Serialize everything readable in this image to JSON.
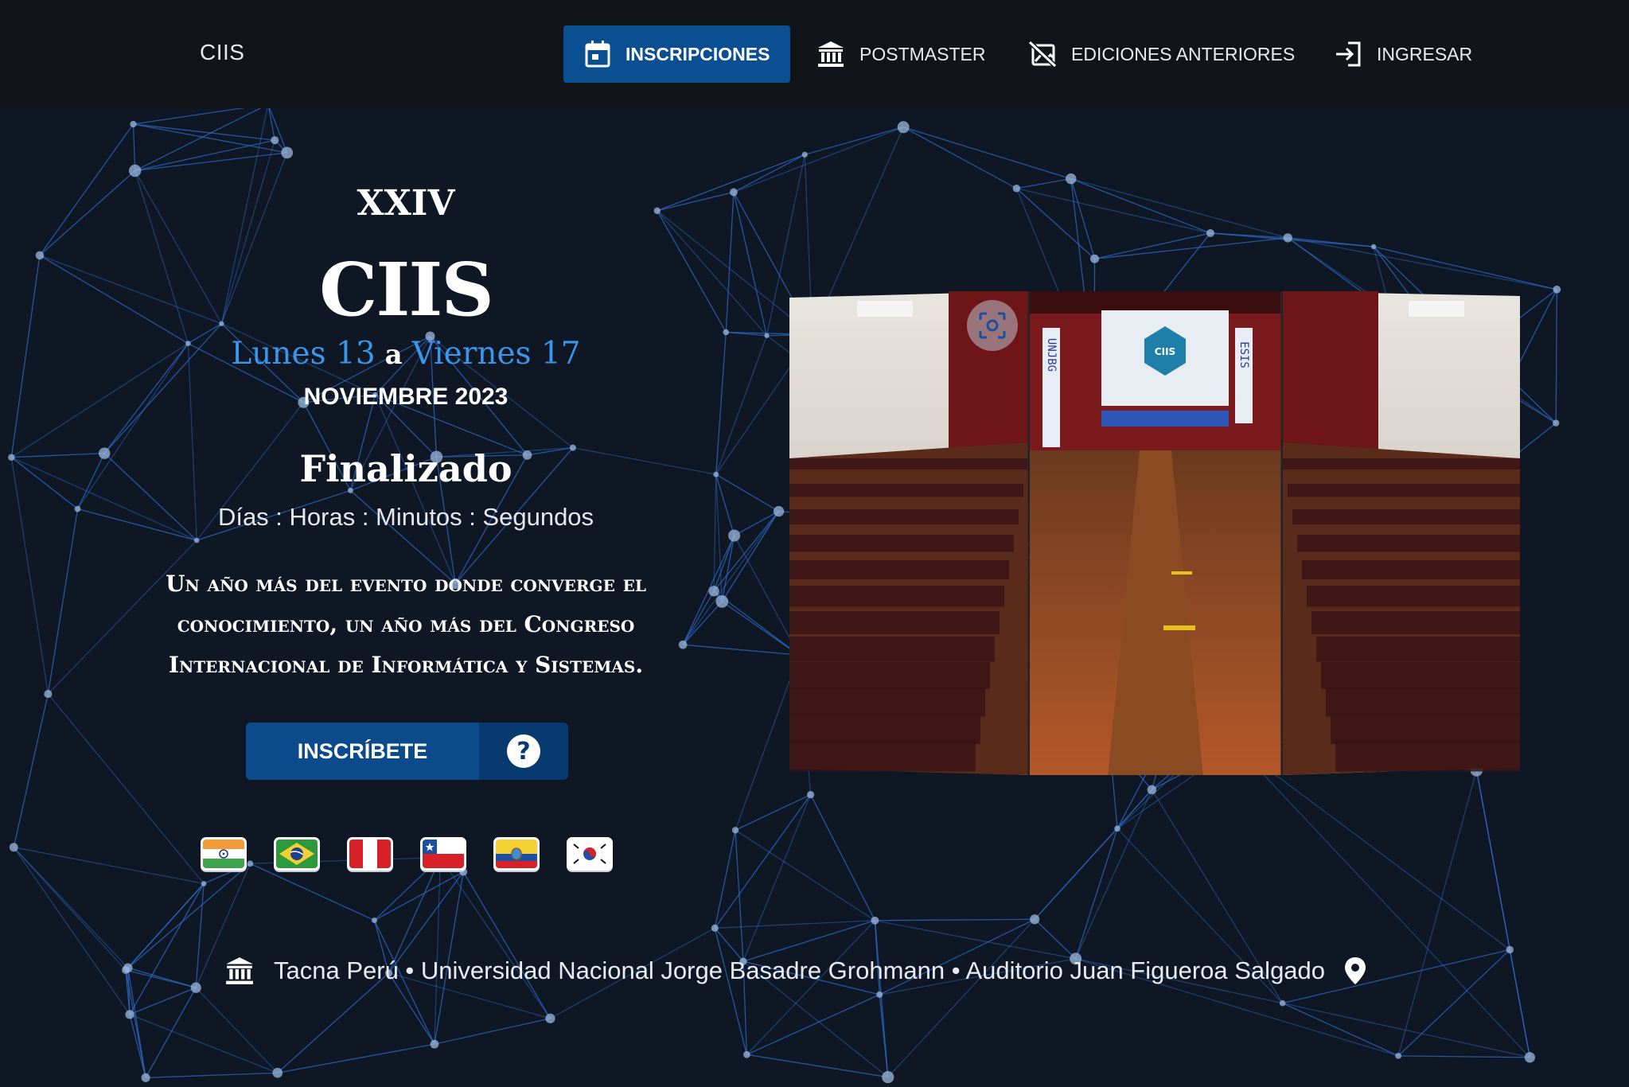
{
  "header": {
    "brand": "CIIS",
    "nav": [
      {
        "label": "INSCRIPCIONES",
        "icon": "calendar-icon",
        "active": true
      },
      {
        "label": "POSTMASTER",
        "icon": "institution-icon"
      },
      {
        "label": "EDICIONES ANTERIORES",
        "icon": "image-off-icon"
      },
      {
        "label": "INGRESAR",
        "icon": "login-icon"
      }
    ]
  },
  "hero": {
    "edition": "XXIV",
    "name": "CIIS",
    "start_day": "Lunes 13",
    "connector": "a",
    "end_day": "Viernes 17",
    "month": "NOVIEMBRE 2023",
    "status": "Finalizado",
    "countdown_units": "Días : Horas : Minutos : Segundos",
    "description": "Un año más del evento donde converge el conocimiento, un año más del Congreso Internacional de Informática y Sistemas.",
    "cta_label": "INSCRÍBETE",
    "help_icon": "question-icon"
  },
  "flags": [
    "India",
    "Brasil",
    "Perú",
    "Chile",
    "Ecuador",
    "Corea del Sur"
  ],
  "photo": {
    "fullscreen_icon": "focus-icon",
    "screen_logo": "CIIS",
    "side_banner_left": "UNJBG",
    "side_banner_right": "ESIS"
  },
  "location": {
    "text": "Tacna Perú • Universidad Nacional Jorge Basadre Grohmann • Auditorio Juan Figueroa Salgado",
    "icon_left": "institution-icon",
    "icon_right": "map-pin-icon"
  },
  "colors": {
    "background": "#0f1724",
    "header": "#111418",
    "accent": "#0b4f93",
    "date_blue": "#3b95e8",
    "network_line": "#2f6fcf"
  }
}
